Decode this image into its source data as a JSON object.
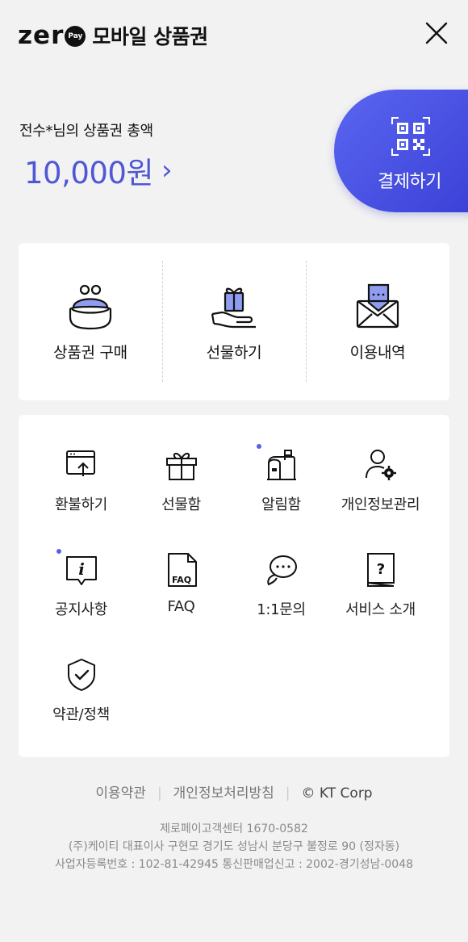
{
  "header": {
    "logo_text": "zer",
    "logo_badge": "Pay",
    "title": "모바일 상품권"
  },
  "balance": {
    "label": "전수*님의 상품권 총액",
    "amount": "10,000원",
    "chevron": "›"
  },
  "pay_button": {
    "label": "결제하기",
    "icon": "qr-code-icon"
  },
  "main_menu": [
    {
      "label": "상품권 구매",
      "icon": "pouch-icon"
    },
    {
      "label": "선물하기",
      "icon": "gift-hand-icon"
    },
    {
      "label": "이용내역",
      "icon": "envelope-icon"
    }
  ],
  "sub_menu": [
    {
      "label": "환불하기",
      "icon": "refund-icon",
      "new": false
    },
    {
      "label": "선물함",
      "icon": "gift-box-icon",
      "new": false
    },
    {
      "label": "알림함",
      "icon": "mailbox-icon",
      "new": true
    },
    {
      "label": "개인정보관리",
      "icon": "user-settings-icon",
      "new": false
    },
    {
      "label": "공지사항",
      "icon": "info-bubble-icon",
      "new": true
    },
    {
      "label": "FAQ",
      "icon": "faq-document-icon",
      "new": false
    },
    {
      "label": "1:1문의",
      "icon": "chat-bubble-icon",
      "new": false
    },
    {
      "label": "서비스 소개",
      "icon": "help-book-icon",
      "new": false
    },
    {
      "label": "약관/정책",
      "icon": "shield-check-icon",
      "new": false
    }
  ],
  "footer": {
    "links": [
      "이용약관",
      "개인정보처리방침"
    ],
    "copyright": "© KT Corp",
    "info": [
      "제로페이고객센터 1670-0582",
      "(주)케이티 대표이사 구현모 경기도 성남시 분당구 불정로 90 (정자동)",
      "사업자등록번호 : 102-81-42945 통신판매업신고 : 2002-경기성남-0048"
    ]
  },
  "colors": {
    "accent": "#4f57d6",
    "pay_gradient_start": "#5a66f0",
    "pay_gradient_end": "#3a3fd6",
    "icon_accent": "#8f9cf0"
  }
}
